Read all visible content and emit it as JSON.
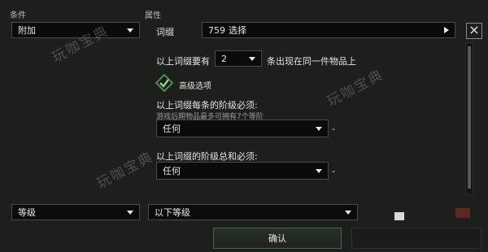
{
  "headers": {
    "condition": "条件",
    "attribute": "属性"
  },
  "left": {
    "condition_value": "附加"
  },
  "affix_row": {
    "label": "词缀",
    "count": "759",
    "select": "选择"
  },
  "require_row": {
    "prefix": "以上词缀要有",
    "value": "2",
    "suffix": "条出现在同一件物品上"
  },
  "advanced": {
    "label": "高级选项",
    "checked": true
  },
  "each_tier": {
    "label": "以上词缀每条的阶级必须:",
    "hint": "游戏后期物品最多可拥有7个等阶",
    "value": "任何",
    "dash": "-"
  },
  "sum_tier": {
    "label": "以上词缀的阶级总和必须:",
    "value": "任何",
    "dash": "-"
  },
  "bottom": {
    "level_select": "等级",
    "level_cond": "以下等级"
  },
  "confirm_label": "确认",
  "close_label": "×",
  "watermark": "玩咖宝典",
  "colors": {
    "accent_green": "#3f6a46",
    "check_green": "#4f8a4f"
  }
}
